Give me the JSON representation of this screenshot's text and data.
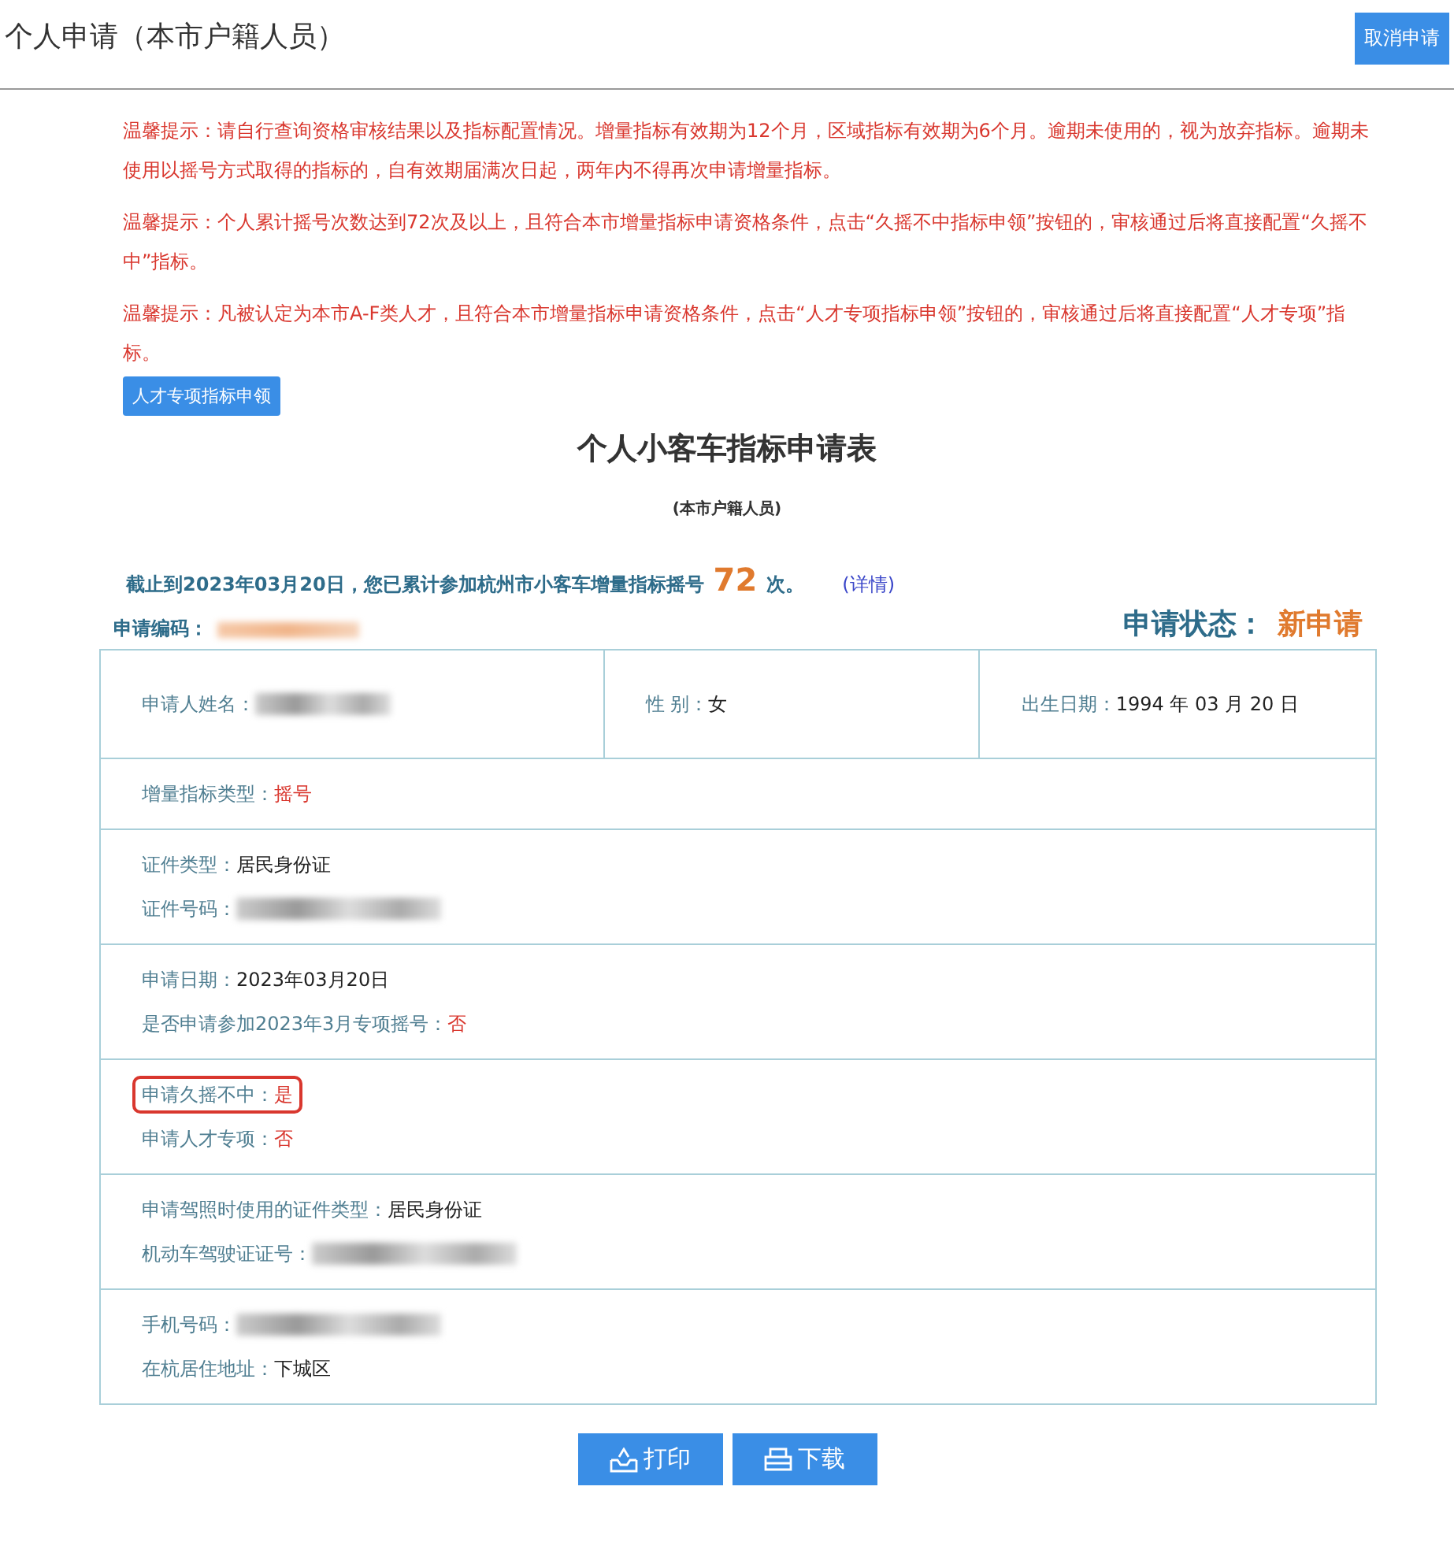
{
  "header": {
    "title": "个人申请（本市户籍人员）",
    "cancel_button": "取消申请"
  },
  "notices": [
    {
      "text": "温馨提示：请自行查询资格审核结果以及指标配置情况。增量指标有效期为12个月，区域指标有效期为6个月。逾期未使用的，视为放弃指标。逾期未使用以摇号方式取得的指标的，自有效期届满次日起，两年内不得再次申请增量指标。"
    },
    {
      "text": "温馨提示：个人累计摇号次数达到72次及以上，且符合本市增量指标申请资格条件，点击“久摇不中指标申领”按钮的，审核通过后将直接配置“久摇不中”指标。"
    },
    {
      "text": "温馨提示：凡被认定为本市A-F类人才，且符合本市增量指标申请资格条件，点击“人才专项指标申领”按钮的，审核通过后将直接配置“人才专项”指标。",
      "button": "人才专项指标申领"
    }
  ],
  "form": {
    "title": "个人小客车指标申请表",
    "subtitle": "(本市户籍人员)"
  },
  "summary": {
    "before": "截止到2023年03月20日，您已累计参加杭州市小客车增量指标摇号",
    "count": "72",
    "after": "次。",
    "link": "(详情)"
  },
  "application_code": {
    "label": "申请编码：",
    "kind": "redacted"
  },
  "status": {
    "label": "申请状态：",
    "value": "新申请"
  },
  "rows": [
    {
      "cells": [
        {
          "lines": [
            {
              "label": "申请人姓名：",
              "kind": "redacted",
              "highlighted": false
            }
          ]
        },
        {
          "lines": [
            {
              "label": "性 别：",
              "value": "女",
              "kind": "text",
              "emphasis": false,
              "highlighted": false
            }
          ]
        },
        {
          "lines": [
            {
              "label": "出生日期：",
              "value": "1994 年 03 月 20 日",
              "kind": "text",
              "emphasis": false,
              "highlighted": false
            }
          ]
        }
      ]
    },
    {
      "cells": [
        {
          "lines": [
            {
              "label": "增量指标类型：",
              "value": "摇号",
              "kind": "text",
              "emphasis": true,
              "highlighted": false
            }
          ]
        }
      ]
    },
    {
      "cells": [
        {
          "lines": [
            {
              "label": "证件类型：",
              "value": "居民身份证",
              "kind": "text",
              "emphasis": false,
              "highlighted": false
            },
            {
              "label": "证件号码：",
              "kind": "redacted",
              "highlighted": false
            }
          ]
        }
      ]
    },
    {
      "cells": [
        {
          "lines": [
            {
              "label": "申请日期：",
              "value": "2023年03月20日",
              "kind": "text",
              "emphasis": false,
              "highlighted": false
            },
            {
              "label": "是否申请参加2023年3月专项摇号：",
              "value": "否",
              "kind": "text",
              "emphasis": true,
              "highlighted": false
            }
          ]
        }
      ]
    },
    {
      "cells": [
        {
          "lines": [
            {
              "label": "申请久摇不中：",
              "value": "是",
              "kind": "text",
              "emphasis": true,
              "highlighted": true
            },
            {
              "label": "申请人才专项：",
              "value": "否",
              "kind": "text",
              "emphasis": true,
              "highlighted": false
            }
          ]
        }
      ]
    },
    {
      "cells": [
        {
          "lines": [
            {
              "label": "申请驾照时使用的证件类型：",
              "value": "居民身份证",
              "kind": "text",
              "emphasis": false,
              "highlighted": false
            },
            {
              "label": "机动车驾驶证证号：",
              "kind": "redacted",
              "highlighted": false
            }
          ]
        }
      ]
    },
    {
      "cells": [
        {
          "lines": [
            {
              "label": "手机号码：",
              "kind": "redacted",
              "highlighted": false
            },
            {
              "label": "在杭居住地址：",
              "value": "下城区",
              "kind": "text",
              "emphasis": false,
              "highlighted": false
            }
          ]
        }
      ]
    }
  ],
  "buttons": [
    {
      "label": "打印",
      "kind": "print"
    },
    {
      "label": "下载",
      "kind": "download"
    }
  ]
}
